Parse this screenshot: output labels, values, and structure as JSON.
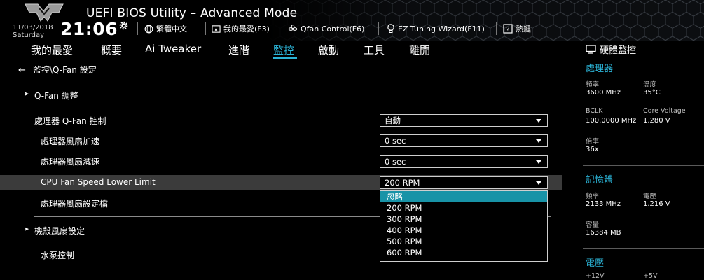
{
  "app_title": "UEFI BIOS Utility – Advanced Mode",
  "date": "11/03/2018",
  "weekday": "Saturday",
  "time": "21:06",
  "header_buttons": {
    "language": "繁體中文",
    "my_favorite": "我的最愛(F3)",
    "qfan_control": "Qfan Control(F6)",
    "ez_tuning": "EZ Tuning Wizard(F11)",
    "hotkeys": "熱鍵"
  },
  "nav": {
    "items": [
      "我的最愛",
      "概要",
      "Ai Tweaker",
      "進階",
      "監控",
      "啟動",
      "工具",
      "離開"
    ],
    "active": "監控"
  },
  "breadcrumb": "監控\\Q-Fan 設定",
  "section_qfan_tuning": "Q-Fan 調整",
  "rows": {
    "cpu_qfan_control": {
      "label": "處理器 Q-Fan 控制",
      "value": "自動"
    },
    "cpu_fan_step_up": {
      "label": "處理器風扇加速",
      "value": "0 sec"
    },
    "cpu_fan_step_down": {
      "label": "處理器風扇減速",
      "value": "0 sec"
    },
    "cpu_fan_lower_limit": {
      "label": "CPU Fan Speed Lower Limit",
      "value": "200 RPM"
    },
    "cpu_fan_profile": {
      "label": "處理器風扇設定檔"
    },
    "chassis_fan_settings": {
      "label": "機殼風扇設定"
    },
    "water_pump_control": {
      "label": "水泵控制"
    }
  },
  "dropdown_options": [
    "忽略",
    "200 RPM",
    "300 RPM",
    "400 RPM",
    "500 RPM",
    "600 RPM"
  ],
  "dropdown_highlighted": "忽略",
  "hw_monitor": {
    "title": "硬體監控",
    "cpu": {
      "title": "處理器",
      "frequency_label": "頻率",
      "frequency": "3600 MHz",
      "temperature_label": "溫度",
      "temperature": "35°C",
      "bclk_label": "BCLK",
      "bclk": "100.0000 MHz",
      "core_voltage_label": "Core Voltage",
      "core_voltage": "1.280 V",
      "ratio_label": "倍率",
      "ratio": "36x"
    },
    "memory": {
      "title": "記憶體",
      "frequency_label": "頻率",
      "frequency": "2133 MHz",
      "voltage_label": "電壓",
      "voltage": "1.216 V",
      "capacity_label": "容量",
      "capacity": "16384 MB"
    },
    "voltage": {
      "title": "電壓",
      "v12_label": "+12V",
      "v5_label": "+5V"
    }
  },
  "colors": {
    "accent": "#2bb3d6",
    "highlight_row": "#3b3b3b",
    "dropdown_selected": "#1893a7"
  }
}
